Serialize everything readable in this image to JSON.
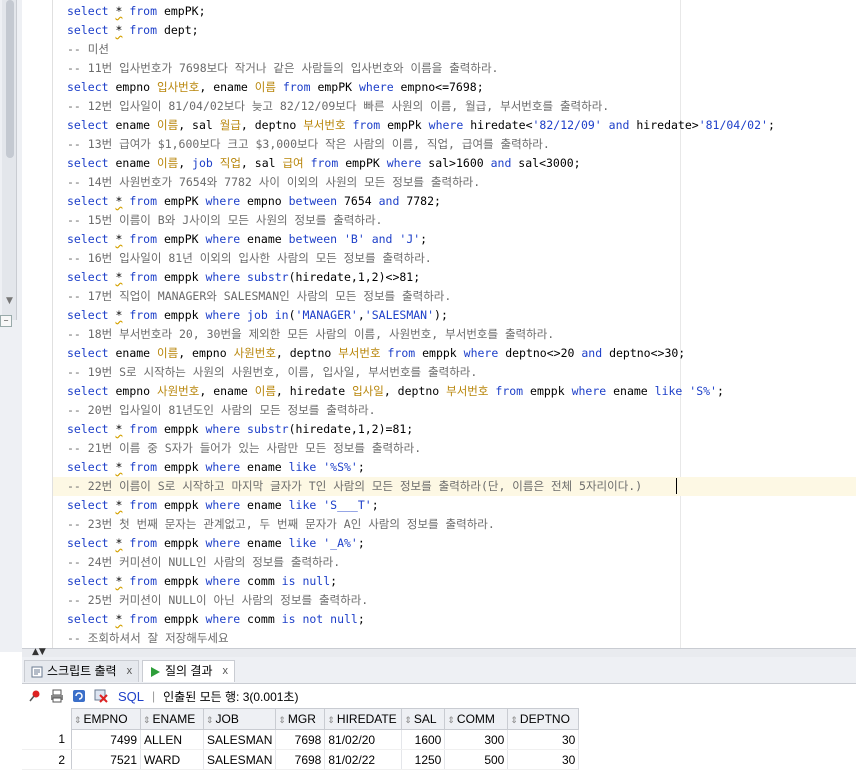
{
  "editor": {
    "lines": [
      [
        [
          "kw",
          "select "
        ],
        [
          "star",
          "*"
        ],
        [
          "kw",
          " from "
        ],
        [
          "t",
          "empPK;"
        ]
      ],
      [
        [
          "kw",
          "select "
        ],
        [
          "star",
          "*"
        ],
        [
          "kw",
          " from "
        ],
        [
          "t",
          "dept;"
        ]
      ],
      [
        [
          "cmt",
          "-- 미션"
        ]
      ],
      [
        [
          "cmt",
          "-- 11번 입사번호가 7698보다 작거나 같은 사람들의 입사번호와 이름을 출력하라."
        ]
      ],
      [
        [
          "kw",
          "select "
        ],
        [
          "t",
          "empno "
        ],
        [
          "alias",
          "입사번호"
        ],
        [
          "t",
          ", ename "
        ],
        [
          "alias",
          "이름"
        ],
        [
          "kw",
          " from "
        ],
        [
          "t",
          "empPK "
        ],
        [
          "kw",
          "where "
        ],
        [
          "t",
          "empno<=7698;"
        ]
      ],
      [
        [
          "cmt",
          "-- 12번 입사일이 81/04/02보다 늦고 82/12/09보다 빠른 사원의 이름, 월급, 부서번호를 출력하라."
        ]
      ],
      [
        [
          "kw",
          "select "
        ],
        [
          "t",
          "ename "
        ],
        [
          "alias",
          "이름"
        ],
        [
          "t",
          ", sal "
        ],
        [
          "alias",
          "월급"
        ],
        [
          "t",
          ", deptno "
        ],
        [
          "alias",
          "부서번호"
        ],
        [
          "kw",
          " from "
        ],
        [
          "t",
          "empPk "
        ],
        [
          "kw",
          "where "
        ],
        [
          "t",
          "hiredate<"
        ],
        [
          "str",
          "'82/12/09'"
        ],
        [
          "kw",
          " and "
        ],
        [
          "t",
          "hiredate>"
        ],
        [
          "str",
          "'81/04/02'"
        ],
        [
          "t",
          ";"
        ]
      ],
      [
        [
          "cmt",
          "-- 13번 급여가 $1,600보다 크고 $3,000보다 작은 사람의 이름, 직업, 급여를 출력하라."
        ]
      ],
      [
        [
          "kw",
          "select "
        ],
        [
          "t",
          "ename "
        ],
        [
          "alias",
          "이름"
        ],
        [
          "t",
          ", "
        ],
        [
          "kw",
          "job "
        ],
        [
          "alias",
          "직업"
        ],
        [
          "t",
          ", sal "
        ],
        [
          "alias",
          "급여"
        ],
        [
          "kw",
          " from "
        ],
        [
          "t",
          "empPK "
        ],
        [
          "kw",
          "where "
        ],
        [
          "t",
          "sal>1600 "
        ],
        [
          "kw",
          "and "
        ],
        [
          "t",
          "sal<3000;"
        ]
      ],
      [
        [
          "cmt",
          "-- 14번 사원번호가 7654와 7782 사이 이외의 사원의 모든 정보를 출력하라."
        ]
      ],
      [
        [
          "kw",
          "select "
        ],
        [
          "star",
          "*"
        ],
        [
          "kw",
          " from "
        ],
        [
          "t",
          "empPK "
        ],
        [
          "kw",
          "where "
        ],
        [
          "t",
          "empno "
        ],
        [
          "kw",
          "between "
        ],
        [
          "t",
          "7654 "
        ],
        [
          "kw",
          "and "
        ],
        [
          "t",
          "7782;"
        ]
      ],
      [
        [
          "cmt",
          "-- 15번 이름이 B와 J사이의 모든 사원의 정보를 출력하라."
        ]
      ],
      [
        [
          "kw",
          "select "
        ],
        [
          "star",
          "*"
        ],
        [
          "kw",
          " from "
        ],
        [
          "t",
          "empPK "
        ],
        [
          "kw",
          "where "
        ],
        [
          "t",
          "ename "
        ],
        [
          "kw",
          "between "
        ],
        [
          "str",
          "'B'"
        ],
        [
          "kw",
          " and "
        ],
        [
          "str",
          "'J'"
        ],
        [
          "t",
          ";"
        ]
      ],
      [
        [
          "cmt",
          "-- 16번 입사일이 81년 이외의 입사한 사람의 모든 정보를 출력하라."
        ]
      ],
      [
        [
          "kw",
          "select "
        ],
        [
          "star",
          "*"
        ],
        [
          "kw",
          " from "
        ],
        [
          "t",
          "emppk "
        ],
        [
          "kw",
          "where "
        ],
        [
          "kw",
          "substr"
        ],
        [
          "t",
          "(hiredate,1,2)<>81;"
        ]
      ],
      [
        [
          "cmt",
          "-- 17번 직업이 MANAGER와 SALESMAN인 사람의 모든 정보를 출력하라."
        ]
      ],
      [
        [
          "kw",
          "select "
        ],
        [
          "star",
          "*"
        ],
        [
          "kw",
          " from "
        ],
        [
          "t",
          "emppk "
        ],
        [
          "kw",
          "where "
        ],
        [
          "kw",
          "job "
        ],
        [
          "kw",
          "in"
        ],
        [
          "t",
          "("
        ],
        [
          "str",
          "'MANAGER'"
        ],
        [
          "t",
          ","
        ],
        [
          "str",
          "'SALESMAN'"
        ],
        [
          "t",
          ");"
        ]
      ],
      [
        [
          "cmt",
          "-- 18번 부서번호라 20, 30번을 제외한 모든 사람의 이름, 사원번호, 부서번호를 출력하라."
        ]
      ],
      [
        [
          "kw",
          "select "
        ],
        [
          "t",
          "ename "
        ],
        [
          "alias",
          "이름"
        ],
        [
          "t",
          ", empno "
        ],
        [
          "alias",
          "사원번호"
        ],
        [
          "t",
          ", deptno "
        ],
        [
          "alias",
          "부서번호"
        ],
        [
          "kw",
          " from "
        ],
        [
          "t",
          "emppk "
        ],
        [
          "kw",
          "where "
        ],
        [
          "t",
          "deptno<>20 "
        ],
        [
          "kw",
          "and "
        ],
        [
          "t",
          "deptno<>30;"
        ]
      ],
      [
        [
          "cmt",
          "-- 19번 S로 시작하는 사원의 사원번호, 이름, 입사일, 부서번호를 출력하라."
        ]
      ],
      [
        [
          "kw",
          "select "
        ],
        [
          "t",
          "empno "
        ],
        [
          "alias",
          "사원번호"
        ],
        [
          "t",
          ", ename "
        ],
        [
          "alias",
          "이름"
        ],
        [
          "t",
          ", hiredate "
        ],
        [
          "alias",
          "입사일"
        ],
        [
          "t",
          ", deptno "
        ],
        [
          "alias",
          "부서번호"
        ],
        [
          "kw",
          " from "
        ],
        [
          "t",
          "emppk "
        ],
        [
          "kw",
          "where "
        ],
        [
          "t",
          "ename "
        ],
        [
          "kw",
          "like "
        ],
        [
          "str",
          "'S%'"
        ],
        [
          "t",
          ";"
        ]
      ],
      [
        [
          "cmt",
          "-- 20번 입사일이 81년도인 사람의 모든 정보를 출력하라."
        ]
      ],
      [
        [
          "kw",
          "select "
        ],
        [
          "star",
          "*"
        ],
        [
          "kw",
          " from "
        ],
        [
          "t",
          "emppk "
        ],
        [
          "kw",
          "where "
        ],
        [
          "kw",
          "substr"
        ],
        [
          "t",
          "(hiredate,1,2)=81;"
        ]
      ],
      [
        [
          "cmt",
          "-- 21번 이름 중 S자가 들어가 있는 사람만 모든 정보를 출력하라."
        ]
      ],
      [
        [
          "kw",
          "select "
        ],
        [
          "star",
          "*"
        ],
        [
          "kw",
          " from "
        ],
        [
          "t",
          "emppk "
        ],
        [
          "kw",
          "where "
        ],
        [
          "t",
          "ename "
        ],
        [
          "kw",
          "like "
        ],
        [
          "str",
          "'%S%'"
        ],
        [
          "t",
          ";"
        ]
      ],
      [
        [
          "cmt",
          "-- 22번 이름이 S로 시작하고 마지막 글자가 T인 사람의 모든 정보를 출력하라(단, 이름은 전체 5자리이다.)"
        ]
      ],
      [
        [
          "kw",
          "select "
        ],
        [
          "star",
          "*"
        ],
        [
          "kw",
          " from "
        ],
        [
          "t",
          "emppk "
        ],
        [
          "kw",
          "where "
        ],
        [
          "t",
          "ename "
        ],
        [
          "kw",
          "like "
        ],
        [
          "str",
          "'S___T'"
        ],
        [
          "t",
          ";"
        ]
      ],
      [
        [
          "cmt",
          "-- 23번 첫 번째 문자는 관계없고, 두 번째 문자가 A인 사람의 정보를 출력하라."
        ]
      ],
      [
        [
          "kw",
          "select "
        ],
        [
          "star",
          "*"
        ],
        [
          "kw",
          " from "
        ],
        [
          "t",
          "emppk "
        ],
        [
          "kw",
          "where "
        ],
        [
          "t",
          "ename "
        ],
        [
          "kw",
          "like "
        ],
        [
          "str",
          "'_A%'"
        ],
        [
          "t",
          ";"
        ]
      ],
      [
        [
          "cmt",
          "-- 24번 커미션이 NULL인 사람의 정보를 출력하라."
        ]
      ],
      [
        [
          "kw",
          "select "
        ],
        [
          "star",
          "*"
        ],
        [
          "kw",
          " from "
        ],
        [
          "t",
          "emppk "
        ],
        [
          "kw",
          "where "
        ],
        [
          "t",
          "comm "
        ],
        [
          "kw",
          "is "
        ],
        [
          "kw",
          "null"
        ],
        [
          "t",
          ";"
        ]
      ],
      [
        [
          "cmt",
          "-- 25번 커미션이 NULL이 아닌 사람의 정보를 출력하라."
        ]
      ],
      [
        [
          "kw",
          "select "
        ],
        [
          "star",
          "*"
        ],
        [
          "kw",
          " from "
        ],
        [
          "t",
          "emppk "
        ],
        [
          "kw",
          "where "
        ],
        [
          "t",
          "comm "
        ],
        [
          "kw",
          "is "
        ],
        [
          "kw",
          "not "
        ],
        [
          "kw",
          "null"
        ],
        [
          "t",
          ";"
        ]
      ],
      [
        [
          "cmt",
          "-- 조회하셔서 잘 저장해두세요"
        ]
      ]
    ],
    "highlighted_line": 25
  },
  "tabs": [
    {
      "label": "스크립트 출력",
      "close": "x",
      "icon": "script-output-icon",
      "active": false
    },
    {
      "label": "질의 결과",
      "close": "x",
      "icon": "run-icon",
      "active": true
    }
  ],
  "toolbar": {
    "sql_label": "SQL",
    "separator": "|",
    "fetch_message": "인출된 모든 행: 3(0.001초)"
  },
  "results": {
    "columns": [
      "EMPNO",
      "ENAME",
      "JOB",
      "MGR",
      "HIREDATE",
      "SAL",
      "COMM",
      "DEPTNO"
    ],
    "rows": [
      [
        "1",
        "7499",
        "ALLEN",
        "SALESMAN",
        "7698",
        "81/02/20",
        "1600",
        "300",
        "30"
      ],
      [
        "2",
        "7521",
        "WARD",
        "SALESMAN",
        "7698",
        "81/02/22",
        "1250",
        "500",
        "30"
      ]
    ]
  },
  "colors": {
    "keyword": "#1d3fc9",
    "alias": "#b8860b",
    "comment": "#6b6b6b",
    "highlight": "#fdf8e4"
  }
}
